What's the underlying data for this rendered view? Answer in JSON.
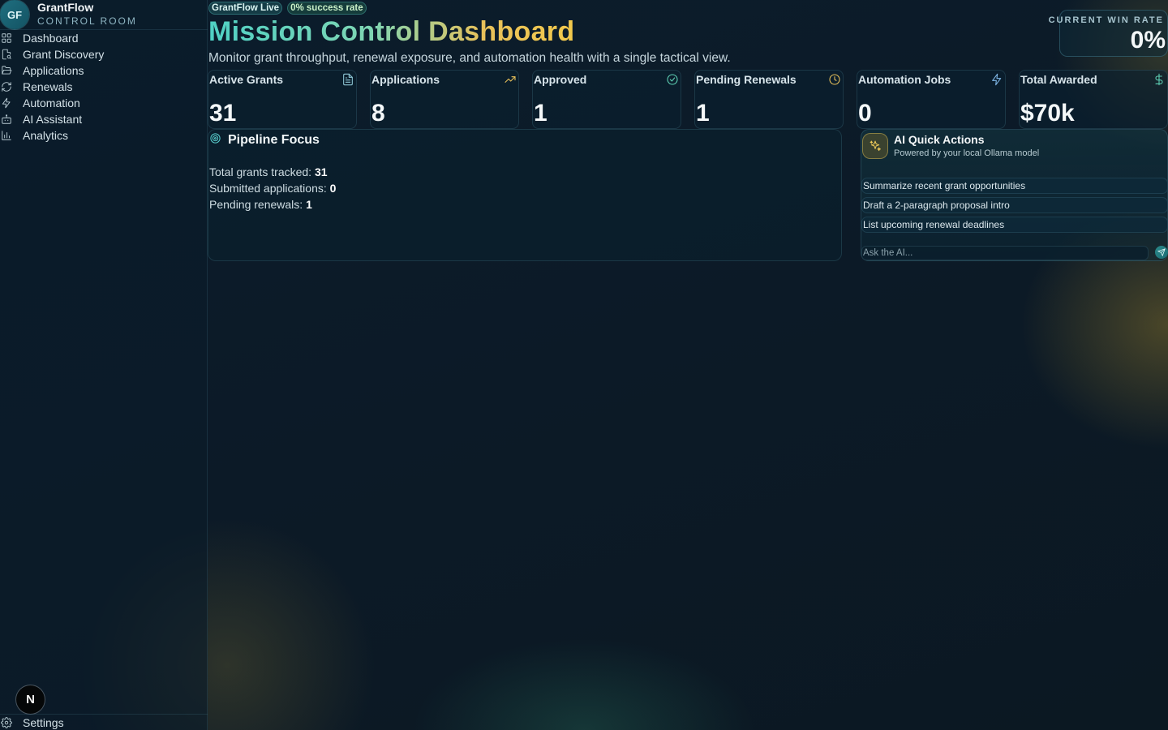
{
  "brand": {
    "logo": "GF",
    "name": "GrantFlow",
    "subtitle": "CONTROL ROOM"
  },
  "sidebar": {
    "items": [
      {
        "label": "Dashboard",
        "icon": "grid-icon"
      },
      {
        "label": "Grant Discovery",
        "icon": "file-search-icon"
      },
      {
        "label": "Applications",
        "icon": "folder-open-icon"
      },
      {
        "label": "Renewals",
        "icon": "refresh-icon"
      },
      {
        "label": "Automation",
        "icon": "lightning-icon"
      },
      {
        "label": "AI Assistant",
        "icon": "bot-icon"
      },
      {
        "label": "Analytics",
        "icon": "bar-chart-icon"
      }
    ],
    "avatar": "N",
    "settings_label": "Settings"
  },
  "header": {
    "badge_live": "GrantFlow Live",
    "badge_rate": "0% success rate",
    "title": "Mission Control Dashboard",
    "subtitle": "Monitor grant throughput, renewal exposure, and automation health with a single tactical view.",
    "winrate_label": "CURRENT WIN RATE",
    "winrate_value": "0%"
  },
  "stats": [
    {
      "label": "Active Grants",
      "value": "31",
      "icon": "document-icon",
      "color": "#8fc8d6"
    },
    {
      "label": "Applications",
      "value": "8",
      "icon": "trending-up-icon",
      "color": "#e8c15a"
    },
    {
      "label": "Approved",
      "value": "1",
      "icon": "check-circle-icon",
      "color": "#5fd1b5"
    },
    {
      "label": "Pending Renewals",
      "value": "1",
      "icon": "clock-icon",
      "color": "#e8c15a"
    },
    {
      "label": "Automation Jobs",
      "value": "0",
      "icon": "lightning-icon",
      "color": "#7fb6e6"
    },
    {
      "label": "Total Awarded",
      "value": "$70k",
      "icon": "dollar-icon",
      "color": "#5fd1b5"
    }
  ],
  "pipeline": {
    "title": "Pipeline Focus",
    "lines": [
      {
        "label": "Total grants tracked:",
        "value": "31"
      },
      {
        "label": "Submitted applications:",
        "value": "0"
      },
      {
        "label": "Pending renewals:",
        "value": "1"
      }
    ]
  },
  "ai": {
    "title": "AI Quick Actions",
    "subtitle": "Powered by your local Ollama model",
    "actions": [
      "Summarize recent grant opportunities",
      "Draft a 2-paragraph proposal intro",
      "List upcoming renewal deadlines"
    ],
    "input_placeholder": "Ask the AI...",
    "input_value": ""
  },
  "colors": {
    "accent_teal": "#4fd1c5",
    "accent_gold": "#f2c94c",
    "background": "#0c1a27"
  }
}
